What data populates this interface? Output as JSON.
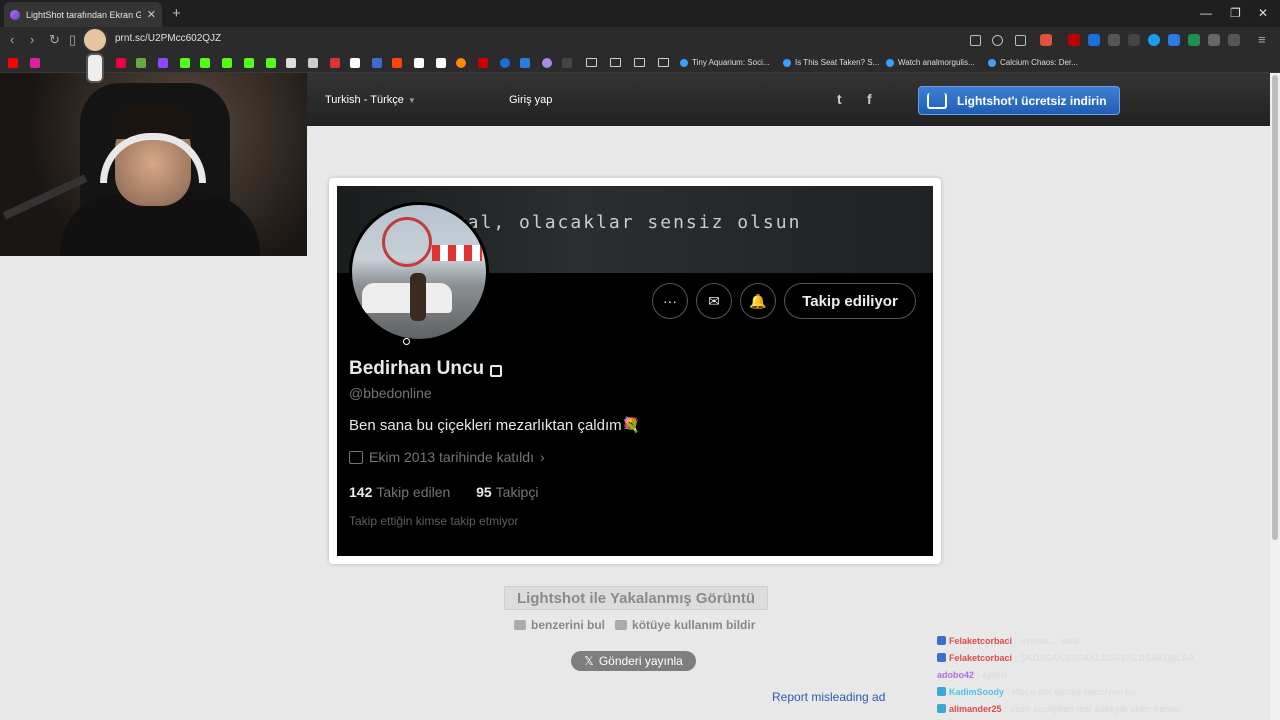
{
  "browser": {
    "tab_title": "LightShot tarafından Ekran Görü",
    "tab_close": "✕",
    "new_tab": "+",
    "url": "prnt.sc/U2PMcc602QJZ",
    "bookmarks": [
      "Tiny Aquarium: Soci...",
      "Is This Seat Taken? S...",
      "Watch analmorgulis...",
      "Calcium Chaos: Der..."
    ]
  },
  "lightshot": {
    "language": "Turkish - Türkçe",
    "login": "Giriş yap",
    "twitter_icon": "t",
    "facebook_icon": "f",
    "download_label": "Lightshot'ı ücretsiz indirin",
    "caption": "Lightshot ile Yakalanmış Görüntü",
    "find_similar": "benzerini bul",
    "report_abuse": "kötüye kullanım bildir",
    "post_label": "Gönderi yayınla",
    "report_ad": "Report misleading ad"
  },
  "profile": {
    "banner_text": "akal, olacaklar sensiz olsun",
    "name": "Bedirhan Uncu",
    "handle": "@bbedonline",
    "bio": "Ben sana bu çiçekleri mezarlıktan çaldım💐",
    "joined": "Ekim 2013 tarihinde katıldı",
    "following_count": "142",
    "following_label": "Takip edilen",
    "followers_count": "95",
    "followers_label": "Takipçi",
    "no_mutual": "Takip ettiğin kimse takip etmiyor",
    "follow_button": "Takip ediliyor",
    "more_icon": "···",
    "message_icon": "✉",
    "notify_icon": "🔔"
  },
  "chat": [
    {
      "user": "Felaketcorbaci",
      "msg": ": uymus ... amk"
    },
    {
      "user": "Felaketcorbaci",
      "msg": ": ŞKDASAKŞSDAKLDSAŞKLDSAKDŞLSA"
    },
    {
      "user": "adobo42",
      "msg": ": aynisi"
    },
    {
      "user": "KadimSoody",
      "msg": ": Muço abi xqcîye benziyon ha"
    },
    {
      "user": "alimander25",
      "msg": ": uzun saçlıyken fesi sokaydı abim benim"
    }
  ]
}
